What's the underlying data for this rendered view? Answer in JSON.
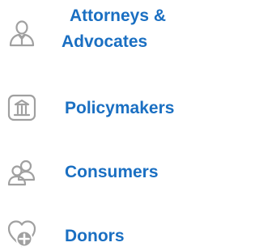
{
  "nav": {
    "items": [
      {
        "label_line1": "Attorneys &",
        "label_line2": "Advocates",
        "icon": "attorney-icon"
      },
      {
        "label": "Policymakers",
        "icon": "government-building-icon"
      },
      {
        "label": "Consumers",
        "icon": "people-group-icon"
      },
      {
        "label": "Donors",
        "icon": "heart-plus-icon"
      }
    ]
  },
  "colors": {
    "link": "#1a6fc2",
    "icon": "#a0a0a0",
    "background": "#ffffff"
  }
}
